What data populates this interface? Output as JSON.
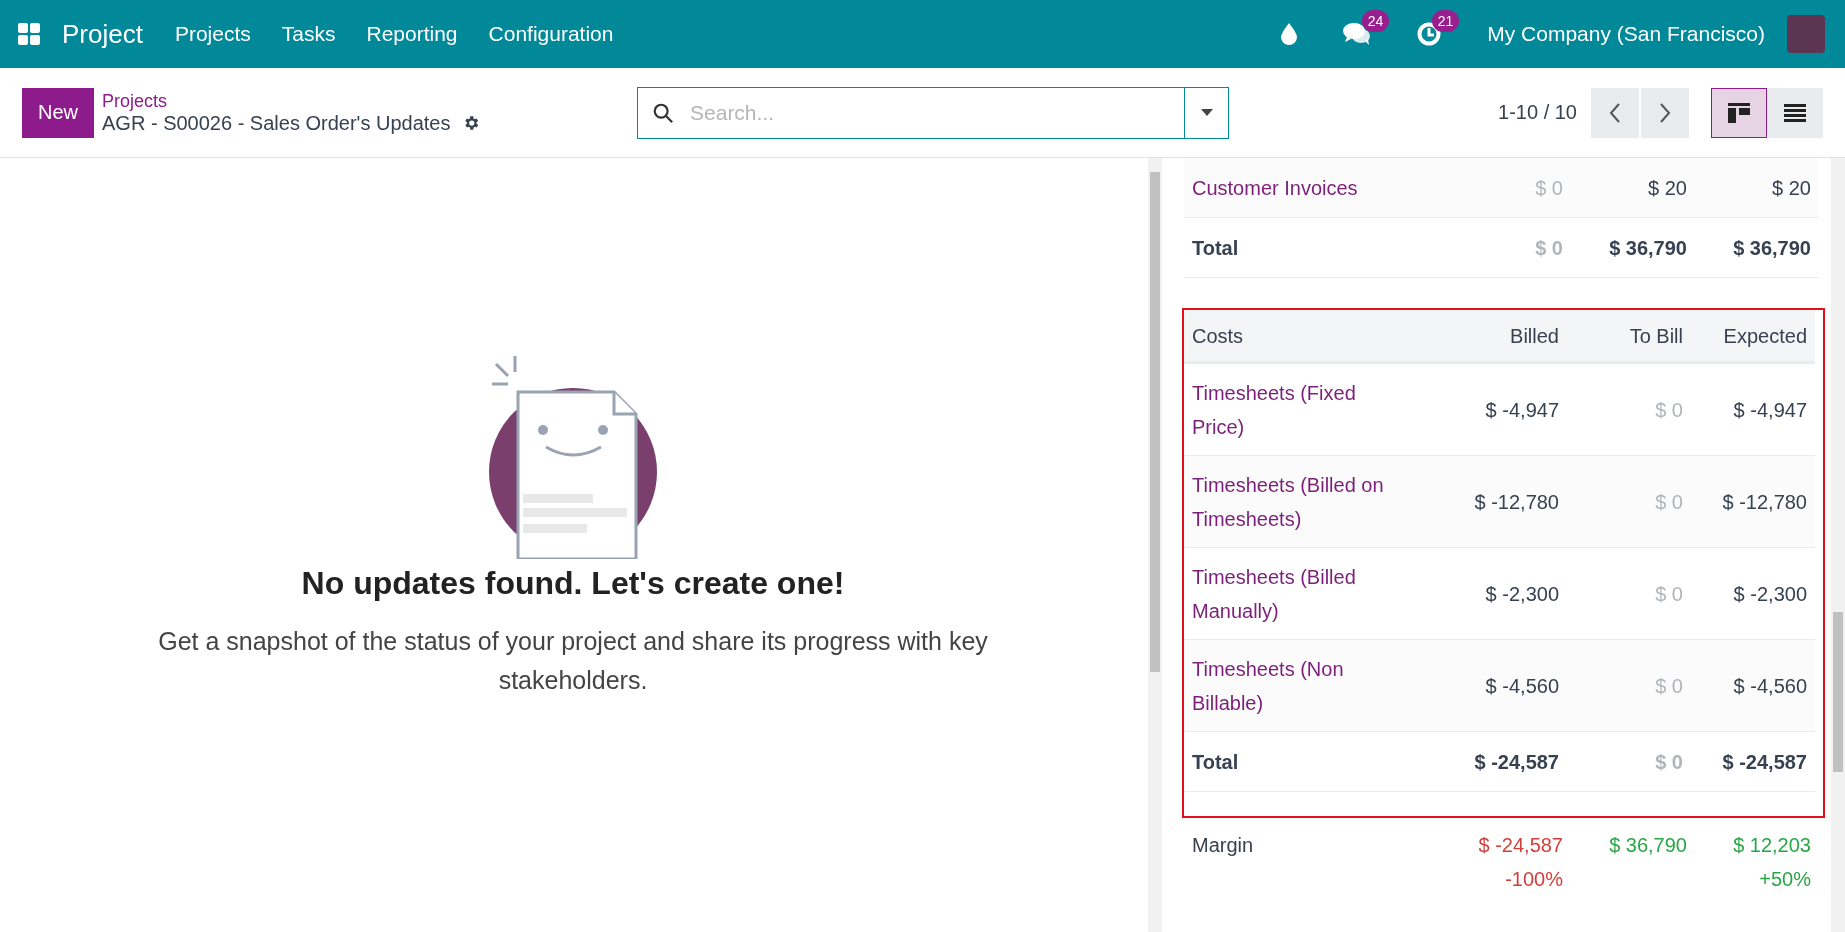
{
  "navbar": {
    "app": "Project",
    "menu": [
      {
        "label": "Projects"
      },
      {
        "label": "Tasks"
      },
      {
        "label": "Reporting"
      },
      {
        "label": "Configuration"
      }
    ],
    "chat_badge": "24",
    "activity_badge": "21",
    "company": "My Company (San Francisco)"
  },
  "control_panel": {
    "new_button": "New",
    "breadcrumb": "Projects",
    "title": "AGR - S00026 - Sales Order's Updates",
    "search": {
      "placeholder": "Search..."
    },
    "pager": "1-10 / 10",
    "views": [
      {
        "kind": "kanban",
        "selected": true
      },
      {
        "kind": "list",
        "selected": false
      }
    ]
  },
  "empty_state": {
    "title": "No updates found. Let's create one!",
    "text": "Get a snapshot of the status of your project and share its progress with key stakeholders."
  },
  "revenues": {
    "rows": [
      {
        "label": "Customer Invoices",
        "billed": {
          "text": "$ 0",
          "muted": true
        },
        "to_bill": {
          "text": "$ 20",
          "muted": false
        },
        "expected": {
          "text": "$ 20",
          "muted": false
        }
      }
    ],
    "total": {
      "label": "Total",
      "billed": {
        "text": "$ 0",
        "muted": true
      },
      "to_bill": {
        "text": "$ 36,790",
        "muted": false
      },
      "expected": {
        "text": "$ 36,790",
        "muted": false
      }
    }
  },
  "costs": {
    "columns": [
      "Costs",
      "Billed",
      "To Bill",
      "Expected"
    ],
    "rows": [
      {
        "label": "Timesheets (Fixed Price)",
        "billed": {
          "text": "$ -4,947",
          "muted": false
        },
        "to_bill": {
          "text": "$ 0",
          "muted": true
        },
        "expected": {
          "text": "$ -4,947",
          "muted": false
        }
      },
      {
        "label": "Timesheets (Billed on Timesheets)",
        "billed": {
          "text": "$ -12,780",
          "muted": false
        },
        "to_bill": {
          "text": "$ 0",
          "muted": true
        },
        "expected": {
          "text": "$ -12,780",
          "muted": false
        }
      },
      {
        "label": "Timesheets (Billed Manually)",
        "billed": {
          "text": "$ -2,300",
          "muted": false
        },
        "to_bill": {
          "text": "$ 0",
          "muted": true
        },
        "expected": {
          "text": "$ -2,300",
          "muted": false
        }
      },
      {
        "label": "Timesheets (Non Billable)",
        "billed": {
          "text": "$ -4,560",
          "muted": false
        },
        "to_bill": {
          "text": "$ 0",
          "muted": true
        },
        "expected": {
          "text": "$ -4,560",
          "muted": false
        }
      }
    ],
    "total": {
      "label": "Total",
      "billed": {
        "text": "$ -24,587",
        "muted": false
      },
      "to_bill": {
        "text": "$ 0",
        "muted": true
      },
      "expected": {
        "text": "$ -24,587",
        "muted": false
      }
    }
  },
  "margin": {
    "label": "Margin",
    "values": [
      {
        "amount": "$ -24,587",
        "percent": "-100%",
        "color": "#d23f3a"
      },
      {
        "amount": "$ 36,790",
        "color": "#28a745"
      },
      {
        "amount": "$ 12,203",
        "percent": "+50%",
        "color": "#28a745"
      }
    ]
  }
}
